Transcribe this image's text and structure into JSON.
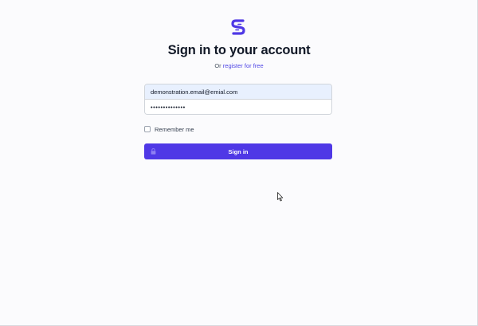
{
  "brand": {
    "logo_icon": "logo-s-icon",
    "accent_color": "#4f38e6"
  },
  "heading": {
    "title": "Sign in to your account",
    "subtitle_prefix": "Or",
    "register_link": "register for free"
  },
  "form": {
    "email_value": "demonstration.email@emial.com",
    "password_value": "••••••••••••••",
    "remember_label": "Remember me",
    "remember_checked": false,
    "submit_label": "Sign in",
    "submit_icon": "lock-icon"
  }
}
